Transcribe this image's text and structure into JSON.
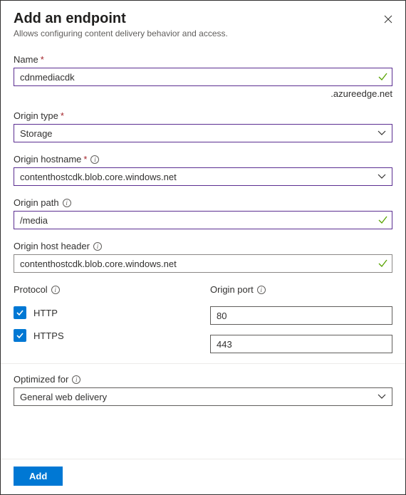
{
  "header": {
    "title": "Add an endpoint",
    "subtitle": "Allows configuring content delivery behavior and access."
  },
  "name": {
    "label": "Name",
    "value": "cdnmediacdk",
    "suffix": ".azureedge.net"
  },
  "originType": {
    "label": "Origin type",
    "value": "Storage"
  },
  "originHostname": {
    "label": "Origin hostname",
    "value": "contenthostcdk.blob.core.windows.net"
  },
  "originPath": {
    "label": "Origin path",
    "value": "/media"
  },
  "originHostHeader": {
    "label": "Origin host header",
    "value": "contenthostcdk.blob.core.windows.net"
  },
  "protocol": {
    "label": "Protocol",
    "http": "HTTP",
    "https": "HTTPS"
  },
  "originPort": {
    "label": "Origin port",
    "http": "80",
    "https": "443"
  },
  "optimizedFor": {
    "label": "Optimized for",
    "value": "General web delivery"
  },
  "footer": {
    "add": "Add"
  },
  "colors": {
    "accent": "#0078d4",
    "inputBorder": "#5b2e91",
    "validGreen": "#57a300"
  }
}
